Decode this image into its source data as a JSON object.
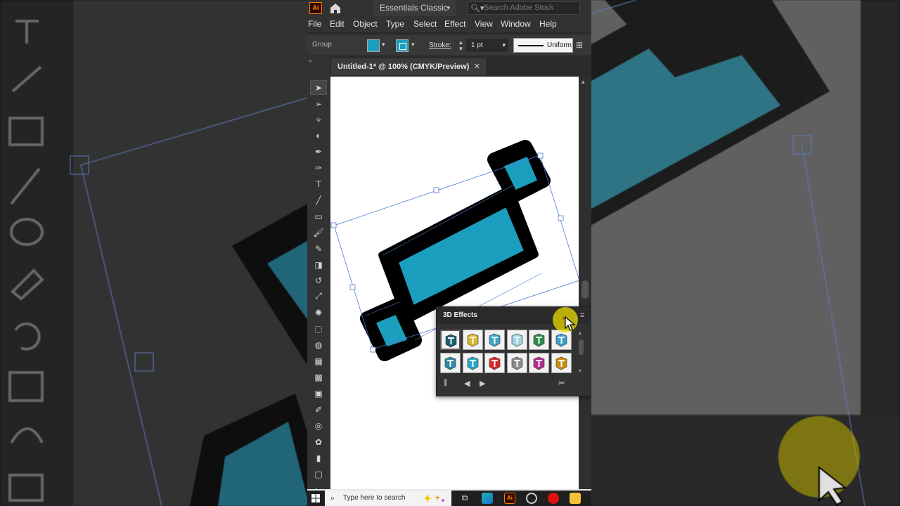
{
  "titlebar": {
    "app_logo": "Ai",
    "workspace_label": "Essentials Classic",
    "stock_search_placeholder": "Search Adobe Stock"
  },
  "menubar": {
    "items": [
      "File",
      "Edit",
      "Object",
      "Type",
      "Select",
      "Effect",
      "View",
      "Window",
      "Help"
    ]
  },
  "control_bar": {
    "selection_label": "Group",
    "fill_color": "#1c9fbe",
    "stroke_label": "Stroke:",
    "stroke_weight": "1 pt",
    "profile_label": "Uniform"
  },
  "document": {
    "tab_title": "Untitled-1* @ 100% (CMYK/Preview)",
    "close_glyph": "✕"
  },
  "tools": [
    "selection-tool-icon",
    "direct-selection-tool-icon",
    "magic-wand-tool-icon",
    "lasso-tool-icon",
    "pen-tool-icon",
    "curvature-tool-icon",
    "type-tool-icon",
    "line-tool-icon",
    "rectangle-tool-icon",
    "paintbrush-tool-icon",
    "shaper-tool-icon",
    "eraser-tool-icon",
    "rotate-tool-icon",
    "scale-tool-icon",
    "warp-tool-icon",
    "free-transform-tool-icon",
    "shape-builder-tool-icon",
    "perspective-grid-tool-icon",
    "mesh-tool-icon",
    "gradient-tool-icon",
    "eyedropper-tool-icon",
    "blend-tool-icon",
    "symbol-sprayer-tool-icon",
    "column-graph-tool-icon",
    "artboard-tool-icon",
    "slice-tool-icon"
  ],
  "fx_panel": {
    "title": "3D Effects",
    "swatch_colors": [
      "#1b5f72",
      "#d8b631",
      "#3fa7c4",
      "#9fd3e0",
      "#2f8a4a",
      "#3aa0c8",
      "#2c8aa6",
      "#29a7c9",
      "#d42a2a",
      "#8c8c8c",
      "#b0308c",
      "#c98d10"
    ]
  },
  "artwork": {
    "fill_color": "#1c9fbe",
    "outline_color": "#000000",
    "selection_color": "#4a7bd0"
  },
  "taskbar": {
    "search_placeholder": "Type here to search"
  }
}
